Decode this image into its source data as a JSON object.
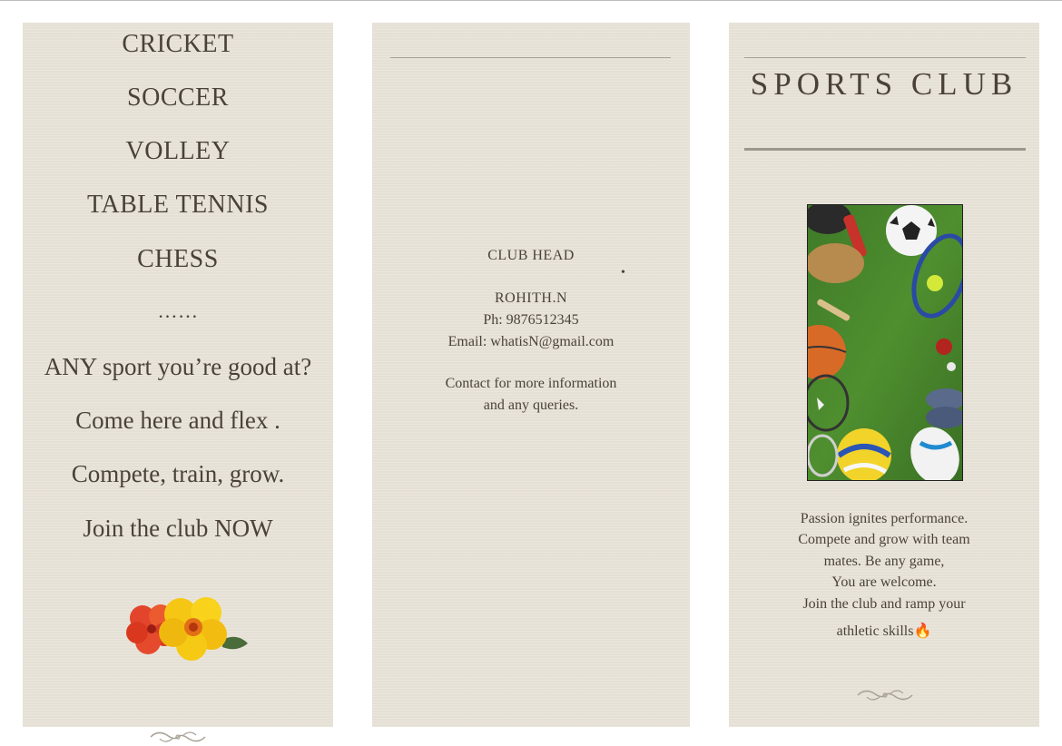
{
  "left_panel": {
    "sports": [
      "CRICKET",
      "SOCCER",
      "VOLLEY",
      "TABLE TENNIS",
      "CHESS"
    ],
    "dots": "……",
    "taglines": [
      "ANY sport you’re good at?",
      "Come here and flex .",
      "Compete, train, grow.",
      "Join the club NOW"
    ]
  },
  "middle_panel": {
    "role": "CLUB HEAD",
    "name": "ROHITH.N",
    "phone": "Ph: 9876512345",
    "email": "Email: whatisN@gmail.com",
    "contact_line1": "Contact for more information",
    "contact_line2": "and any queries.",
    "bullet": "•"
  },
  "right_panel": {
    "title": "SPORTS CLUB",
    "description": [
      "Passion ignites performance.",
      "Compete and grow with team",
      "mates. Be any game,",
      "You are welcome.",
      "Join the club and ramp your",
      "athletic skills🔥"
    ]
  },
  "icons": {
    "flower": "hibiscus-flower-icon",
    "ornament": "flourish-ornament-icon",
    "photo": "sports-equipment-photo"
  }
}
